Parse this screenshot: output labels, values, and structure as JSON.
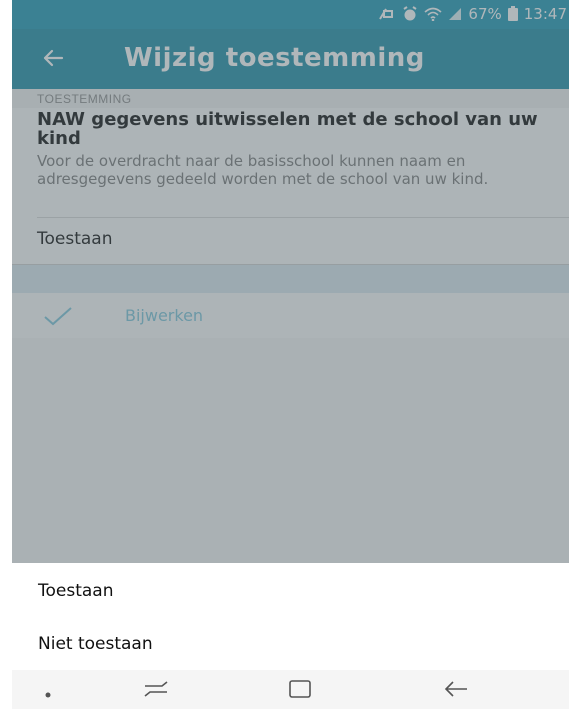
{
  "status_bar": {
    "battery_percent": "67%",
    "time": "13:47",
    "icons": [
      "mute-vibrate-icon",
      "alarm-icon",
      "wifi-icon",
      "signal-icon",
      "battery-icon"
    ]
  },
  "toolbar": {
    "back_icon": "arrow-left-icon",
    "title": "Wijzig toestemming"
  },
  "content": {
    "section_header": "TOESTEMMING",
    "permission_title": "NAW gegevens uitwisselen met de school van uw kind",
    "permission_description": "Voor de overdracht naar de basisschool kunnen naam en adresgegevens gedeeld worden met de school van uw kind.",
    "current_value": "Toestaan",
    "update_icon": "check-icon",
    "update_label": "Bijwerken"
  },
  "bottom_sheet": {
    "options": [
      "Toestaan",
      "Niet toestaan"
    ]
  },
  "nav_bar": {
    "buttons": [
      "dot-icon",
      "recent-apps-icon",
      "home-icon",
      "back-icon"
    ]
  },
  "colors": {
    "status_bar": "#1f97b4",
    "toolbar": "#1f8ea8",
    "accent_disabled": "#7ec4d8"
  }
}
